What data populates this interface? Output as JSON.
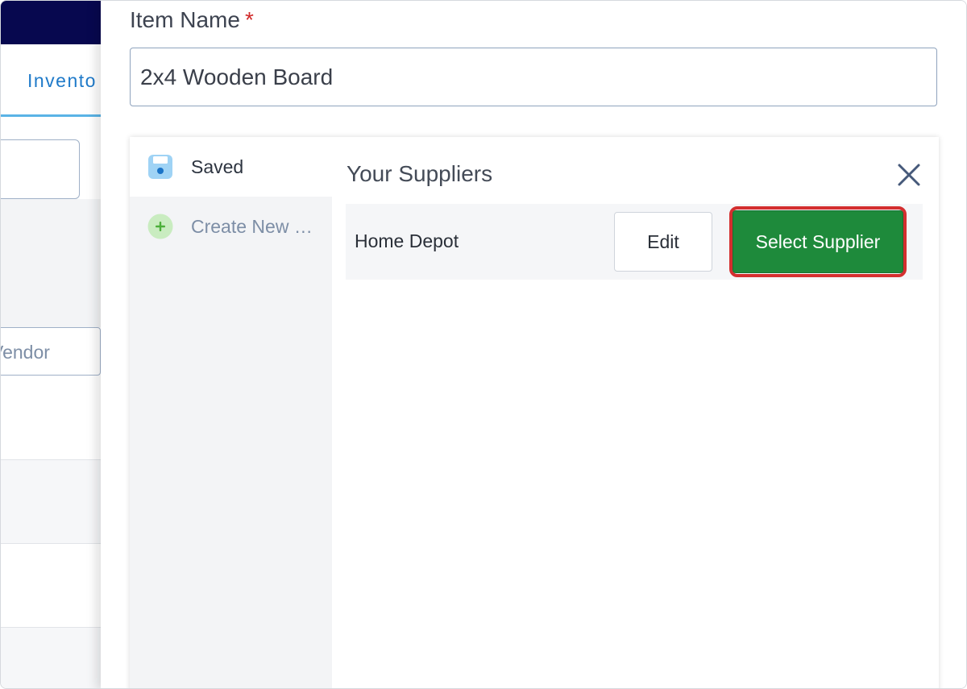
{
  "background_page": {
    "tab_label": "Invento",
    "vendor_placeholder": "Vendor"
  },
  "modal": {
    "item_name": {
      "label": "Item Name",
      "required_marker": "*",
      "value": "2x4 Wooden Board"
    },
    "side_menu": {
      "items": [
        {
          "label": "Saved",
          "icon": "floppy-disk-icon"
        },
        {
          "label": "Create New …",
          "icon": "plus-circle-icon"
        }
      ]
    },
    "suppliers": {
      "title": "Your Suppliers",
      "close_icon": "close-icon",
      "rows": [
        {
          "name": "Home Depot",
          "edit_label": "Edit",
          "select_label": "Select Supplier"
        }
      ]
    }
  },
  "colors": {
    "navbar": "#07084f",
    "tab_text": "#1f7ac9",
    "select_button": "#1e8a3b",
    "highlight_outline": "#d32f2f",
    "required_star": "#d12a2a"
  }
}
